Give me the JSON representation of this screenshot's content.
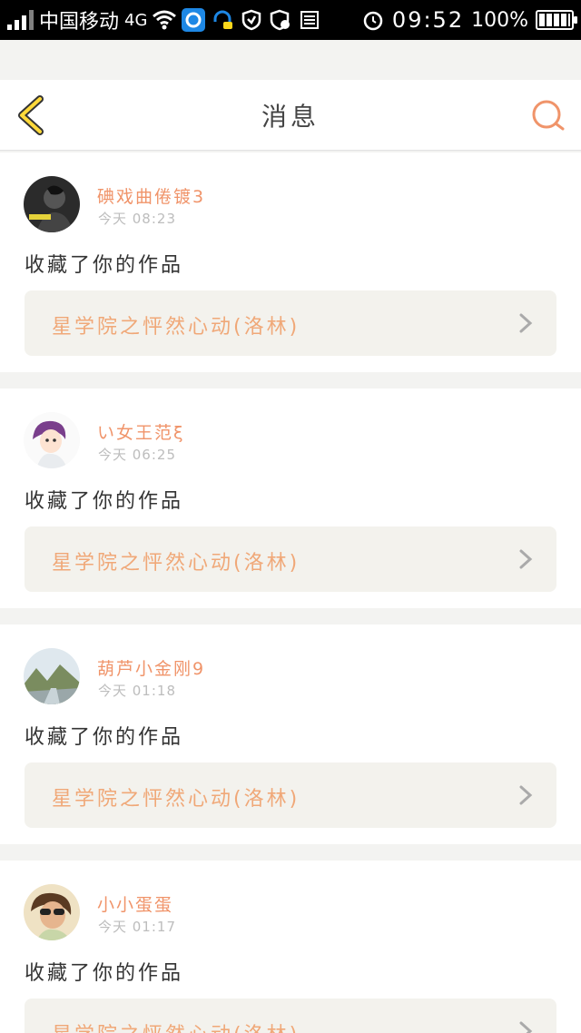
{
  "status_bar": {
    "carrier": "中国移动",
    "network": "4G",
    "time": "09:52",
    "battery": "100%",
    "icons": [
      "signal-icon",
      "wifi-icon",
      "app-notification-icon",
      "headset-icon",
      "shield-icon",
      "shield-check-icon",
      "storage-icon",
      "alarm-icon",
      "battery-icon"
    ]
  },
  "header": {
    "title": "消息",
    "back_icon": "chevron-left-icon",
    "search_icon": "search-icon"
  },
  "colors": {
    "accent": "#f0946a",
    "background": "#f3f3f1",
    "card": "#ffffff",
    "link_bg": "#f3f2ed",
    "back_icon_fill": "#ffd93a"
  },
  "messages": [
    {
      "username": "碘戏曲倦镀3",
      "time": "今天 08:23",
      "action": "收藏了你的作品",
      "work_title": "星学院之怦然心动(洛林)",
      "avatar": "avatar-dark"
    },
    {
      "username": "い女王范ξ",
      "time": "今天 06:25",
      "action": "收藏了你的作品",
      "work_title": "星学院之怦然心动(洛林)",
      "avatar": "avatar-anime"
    },
    {
      "username": "葫芦小金刚9",
      "time": "今天 01:18",
      "action": "收藏了你的作品",
      "work_title": "星学院之怦然心动(洛林)",
      "avatar": "avatar-landscape"
    },
    {
      "username": "小小蛋蛋",
      "time": "今天 01:17",
      "action": "收藏了你的作品",
      "work_title": "星学院之怦然心动(洛林)",
      "avatar": "avatar-sunglasses"
    }
  ]
}
